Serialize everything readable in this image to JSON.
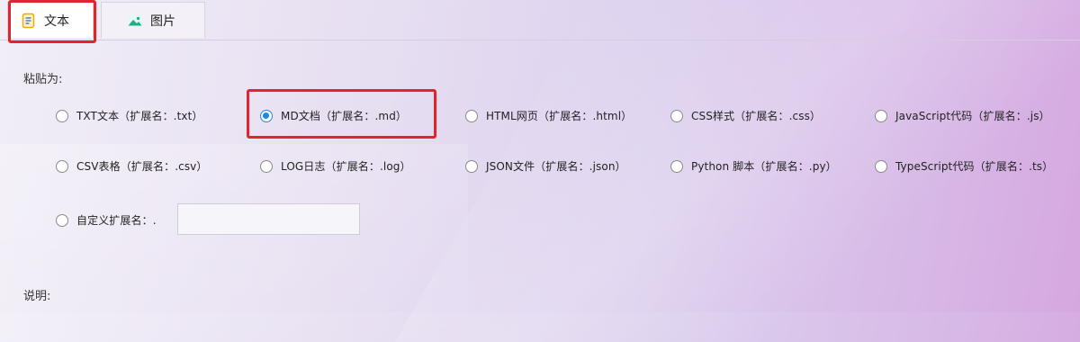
{
  "tabs": [
    {
      "label": "文本",
      "icon": "text-doc-icon",
      "active": true
    },
    {
      "label": "图片",
      "icon": "image-icon",
      "active": false
    }
  ],
  "paste_as_label": "粘贴为:",
  "options": [
    {
      "label": "TXT文本（扩展名：.txt）",
      "checked": false
    },
    {
      "label": "MD文档（扩展名：.md）",
      "checked": true
    },
    {
      "label": "HTML网页（扩展名：.html）",
      "checked": false
    },
    {
      "label": "CSS样式（扩展名：.css）",
      "checked": false
    },
    {
      "label": "JavaScript代码（扩展名：.js）",
      "checked": false
    },
    {
      "label": "CSV表格（扩展名：.csv）",
      "checked": false
    },
    {
      "label": "LOG日志（扩展名：.log）",
      "checked": false
    },
    {
      "label": "JSON文件（扩展名：.json）",
      "checked": false
    },
    {
      "label": "Python 脚本（扩展名：.py）",
      "checked": false
    },
    {
      "label": "TypeScript代码（扩展名：.ts）",
      "checked": false
    }
  ],
  "custom": {
    "label": "自定义扩展名：.",
    "value": "",
    "checked": false
  },
  "description_label": "说明:",
  "colors": {
    "accent": "#1e88e5",
    "highlight": "#e0262c"
  }
}
